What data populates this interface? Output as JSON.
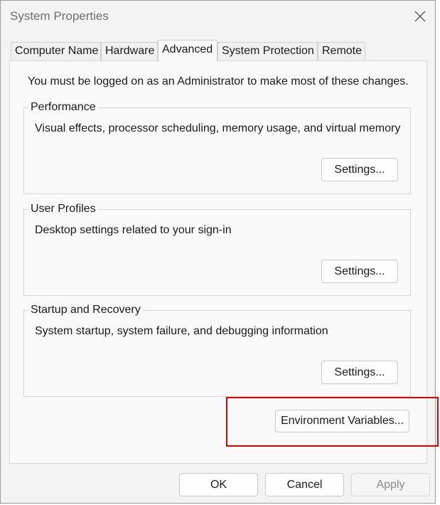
{
  "window": {
    "title": "System Properties"
  },
  "tabs": [
    {
      "label": "Computer Name",
      "active": false
    },
    {
      "label": "Hardware",
      "active": false
    },
    {
      "label": "Advanced",
      "active": true
    },
    {
      "label": "System Protection",
      "active": false
    },
    {
      "label": "Remote",
      "active": false
    }
  ],
  "advanced": {
    "admin_note": "You must be logged on as an Administrator to make most of these changes.",
    "performance": {
      "legend": "Performance",
      "description": "Visual effects, processor scheduling, memory usage, and virtual memory",
      "button": "Settings..."
    },
    "user_profiles": {
      "legend": "User Profiles",
      "description": "Desktop settings related to your sign-in",
      "button": "Settings..."
    },
    "startup_recovery": {
      "legend": "Startup and Recovery",
      "description": "System startup, system failure, and debugging information",
      "button": "Settings..."
    },
    "env_button": "Environment Variables..."
  },
  "footer": {
    "ok": "OK",
    "cancel": "Cancel",
    "apply": "Apply",
    "apply_enabled": false
  },
  "colors": {
    "highlight": "#e00000",
    "window_bg": "#f3f3f3",
    "panel_bg": "#f9f9f9"
  },
  "icons": {
    "close": "close-icon"
  }
}
